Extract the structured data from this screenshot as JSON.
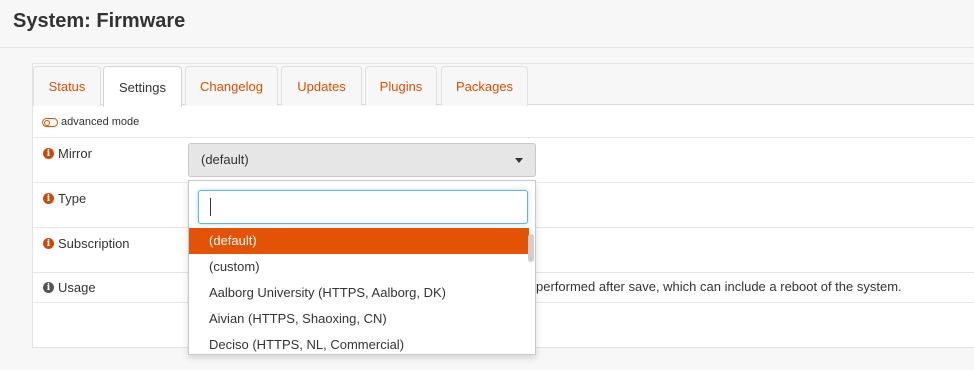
{
  "page": {
    "title": "System: Firmware"
  },
  "tabs": [
    {
      "label": "Status"
    },
    {
      "label": "Settings"
    },
    {
      "label": "Changelog"
    },
    {
      "label": "Updates"
    },
    {
      "label": "Plugins"
    },
    {
      "label": "Packages"
    }
  ],
  "active_tab": "Settings",
  "advanced_mode_label": "advanced mode",
  "fields": {
    "mirror": {
      "label": "Mirror",
      "value": "(default)"
    },
    "type": {
      "label": "Type"
    },
    "subscription": {
      "label": "Subscription"
    },
    "usage": {
      "label": "Usage",
      "text_visible": "performed after save, which can include a reboot of the system."
    }
  },
  "dropdown": {
    "search_value": "",
    "options": [
      "(default)",
      "(custom)",
      "Aalborg University (HTTPS, Aalborg, DK)",
      "Aivian (HTTPS, Shaoxing, CN)",
      "Deciso (HTTPS, NL, Commercial)"
    ],
    "selected_index": 0
  },
  "colors": {
    "accent": "#d94f00",
    "selected_bg": "#e35205",
    "info_icon": "#c94a0c"
  }
}
